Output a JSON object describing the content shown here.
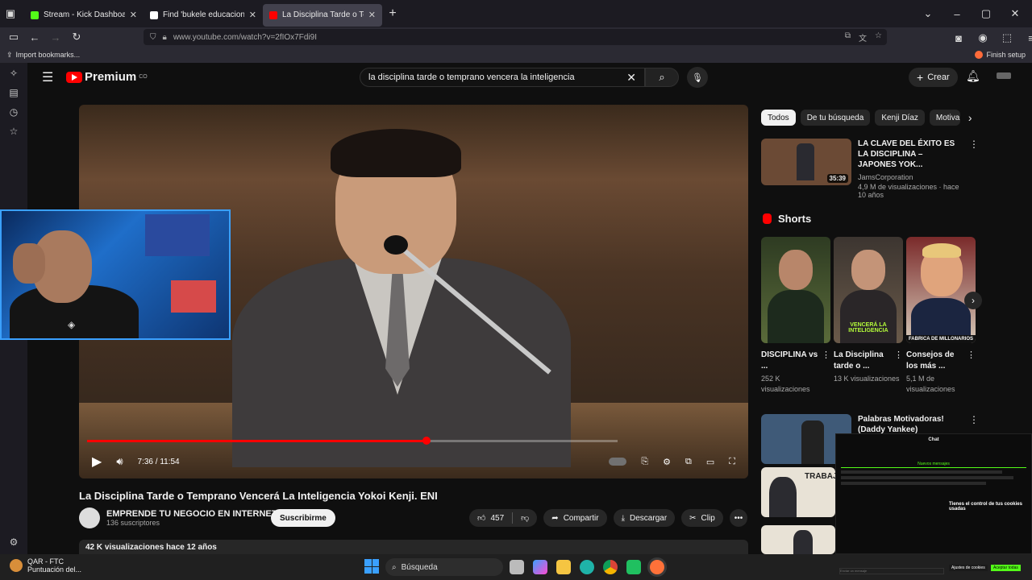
{
  "browser": {
    "tabs": [
      {
        "title": "Stream - Kick Dashboard",
        "favicon_color": "#53fc18",
        "active": false
      },
      {
        "title": "Find 'bukele educacion' on TikT",
        "favicon_color": "#000000",
        "active": false
      },
      {
        "title": "La Disciplina Tarde o Temprano",
        "favicon_color": "#ff0000",
        "active": true
      }
    ],
    "url": "www.youtube.com/watch?v=2fIOx7Fdi9I",
    "import_bookmarks": "Import bookmarks...",
    "finish_setup": "Finish setup"
  },
  "youtube": {
    "logo_text": "Premium",
    "logo_sup": "CO",
    "search_query": "la disciplina tarde o temprano vencera la inteligencia",
    "create_label": "Crear"
  },
  "player": {
    "current_time": "7:36",
    "duration": "11:54",
    "progress": 0.64
  },
  "video": {
    "title": "La Disciplina Tarde o Temprano Vencerá La Inteligencia Yokoi Kenji. ENI",
    "channel_name": "EMPRENDE TU NEGOCIO EN INTERNET",
    "subscribers": "136 suscriptores",
    "subscribe_label": "Suscribirme",
    "likes": "457",
    "share_label": "Compartir",
    "download_label": "Descargar",
    "clip_label": "Clip",
    "views_date": "42 K visualizaciones  hace 12 años"
  },
  "chips": [
    "Todos",
    "De tu búsqueda",
    "Kenji Díaz",
    "Motiva"
  ],
  "recommendations": [
    {
      "title": "LA CLAVE DEL ÉXITO ES LA DISCIPLINA – JAPONES YOK...",
      "channel": "JamsCorporation",
      "meta": "4,9 M de visualizaciones · hace 10 años",
      "duration": "35:39",
      "thumb_color": "#6b4a35"
    },
    {
      "title": "Palabras Motivadoras! (Daddy Yankee)",
      "channel": "",
      "meta": "",
      "duration": "",
      "thumb_color": "#3f5a78"
    }
  ],
  "shorts": {
    "heading": "Shorts",
    "items": [
      {
        "title": "DISCIPLINA vs ...",
        "views": "252 K visualizaciones",
        "overlay": "",
        "color": "#2e3b22"
      },
      {
        "title": "La Disciplina tarde o ...",
        "views": "13 K visualizaciones",
        "overlay": "VENCERÁ LA INTELIGENCIA",
        "color": "#3c3530"
      },
      {
        "title": "Consejos de los más ...",
        "views": "5,1 M de visualizaciones",
        "overlay": "FABRICA DE MILLONARIOS",
        "color": "#7a2a2a"
      }
    ]
  },
  "thumb_labels": {
    "trabaja": "TRABAJA"
  },
  "chat": {
    "title": "Chat",
    "new_messages": "Nuevos mensajes",
    "cookie_title": "Tienes el control de tus cookies usadas",
    "cookie_btn_settings": "Ajustes de cookies",
    "cookie_btn_accept": "Aceptar todas",
    "input_placeholder": "Enviar un mensaje"
  },
  "taskbar": {
    "weather_title": "QAR - FTC",
    "weather_sub": "Puntuación del...",
    "search_label": "Búsqueda"
  }
}
